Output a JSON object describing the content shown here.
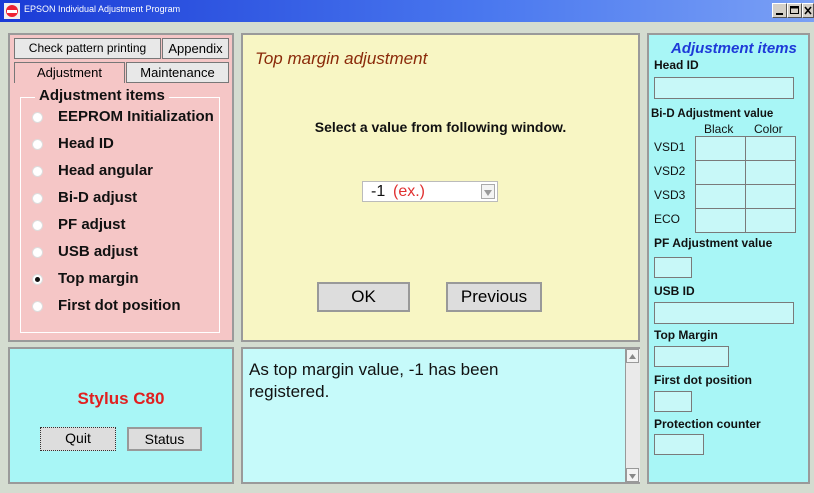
{
  "window": {
    "title": "EPSON Individual Adjustment Program"
  },
  "tabs": {
    "check_pattern": "Check pattern printing",
    "appendix": "Appendix",
    "adjustment": "Adjustment",
    "maintenance": "Maintenance"
  },
  "adjustment_group": {
    "title": "Adjustment items",
    "items": [
      {
        "label": "EEPROM Initialization",
        "selected": false
      },
      {
        "label": "Head ID",
        "selected": false
      },
      {
        "label": "Head angular",
        "selected": false
      },
      {
        "label": "Bi-D adjust",
        "selected": false
      },
      {
        "label": "PF adjust",
        "selected": false
      },
      {
        "label": "USB adjust",
        "selected": false
      },
      {
        "label": "Top margin",
        "selected": true
      },
      {
        "label": "First dot position",
        "selected": false
      }
    ]
  },
  "main": {
    "heading": "Top margin adjustment",
    "instruction": "Select a value from following window.",
    "select_value": "-1",
    "select_suffix": "(ex.)",
    "ok_label": "OK",
    "previous_label": "Previous"
  },
  "status_panel": {
    "model": "Stylus C80",
    "quit_label": "Quit",
    "status_label": "Status"
  },
  "message": {
    "text": "As top margin value, -1 has been registered."
  },
  "right_panel": {
    "title": "Adjustment items",
    "head_id": "Head ID",
    "bid_title": "Bi-D Adjustment value",
    "col_black": "Black",
    "col_color": "Color",
    "rows": [
      "VSD1",
      "VSD2",
      "VSD3",
      "ECO"
    ],
    "pf_title": "PF Adjustment value",
    "usb_id": "USB ID",
    "top_margin": "Top Margin",
    "first_dot": "First dot position",
    "protection": "Protection counter"
  },
  "colors": {
    "title_bar": "#2a4fe0",
    "left_panel_bg": "#f8c8c8",
    "main_panel_bg": "#f8f8c0",
    "cyan_bg": "#a8f8f8",
    "right_title": "#1e3ad8",
    "model_text": "#e02020",
    "heading_text": "#8a2a0a"
  }
}
